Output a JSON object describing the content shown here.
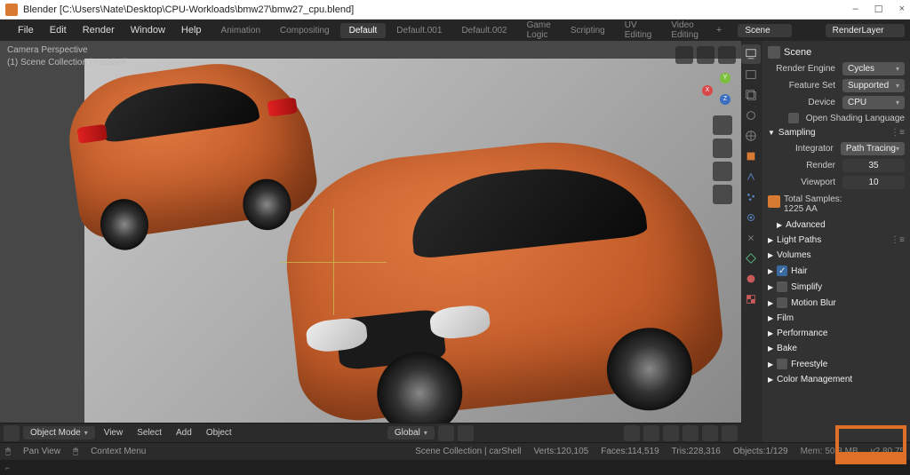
{
  "window": {
    "title": "Blender  [C:\\Users\\Nate\\Desktop\\CPU-Workloads\\bmw27\\bmw27_cpu.blend]",
    "minimize": "–",
    "maximize": "☐",
    "close": "×"
  },
  "top_menu": {
    "file": "File",
    "edit": "Edit",
    "render": "Render",
    "window": "Window",
    "help": "Help"
  },
  "workspaces": {
    "animation": "Animation",
    "compositing": "Compositing",
    "default": "Default",
    "default001": "Default.001",
    "default002": "Default.002",
    "game_logic": "Game Logic",
    "scripting": "Scripting",
    "uv_editing": "UV Editing",
    "video_editing": "Video Editing",
    "plus": "+"
  },
  "scene_field": "Scene",
  "layer_field": "RenderLayer",
  "viewport": {
    "line1": "Camera Perspective",
    "line2": "(1) Scene Collection | carShell"
  },
  "viewport_header": {
    "editor_icon": "▦",
    "object_mode": "Object Mode",
    "view": "View",
    "select": "Select",
    "add": "Add",
    "object": "Object",
    "global": "Global"
  },
  "properties": {
    "scene_name": "Scene",
    "render_engine": {
      "label": "Render Engine",
      "value": "Cycles"
    },
    "feature_set": {
      "label": "Feature Set",
      "value": "Supported"
    },
    "device": {
      "label": "Device",
      "value": "CPU"
    },
    "osl": {
      "label": "Open Shading Language"
    },
    "sampling_header": "Sampling",
    "integrator": {
      "label": "Integrator",
      "value": "Path Tracing"
    },
    "render": {
      "label": "Render",
      "value": "35"
    },
    "viewport_samples": {
      "label": "Viewport",
      "value": "10"
    },
    "total_samples_label": "Total Samples:",
    "total_samples_value": "1225 AA",
    "advanced": "Advanced",
    "light_paths": "Light Paths",
    "volumes": "Volumes",
    "hair": "Hair",
    "simplify": "Simplify",
    "motion_blur": "Motion Blur",
    "film": "Film",
    "performance": "Performance",
    "bake": "Bake",
    "freestyle": "Freestyle",
    "color_management": "Color Management"
  },
  "status": {
    "pan_view": "Pan View",
    "context_menu": "Context Menu",
    "scene_path": "Scene Collection | carShell",
    "verts": "Verts:120,105",
    "faces": "Faces:114,519",
    "tris": "Tris:228,316",
    "objects": "Objects:1/129",
    "mem": "Mem: 50.8 MB",
    "version": "v2.80.75"
  },
  "colors": {
    "accent": "#d97a33",
    "panel": "#323232",
    "blue": "#3a6aa0"
  }
}
